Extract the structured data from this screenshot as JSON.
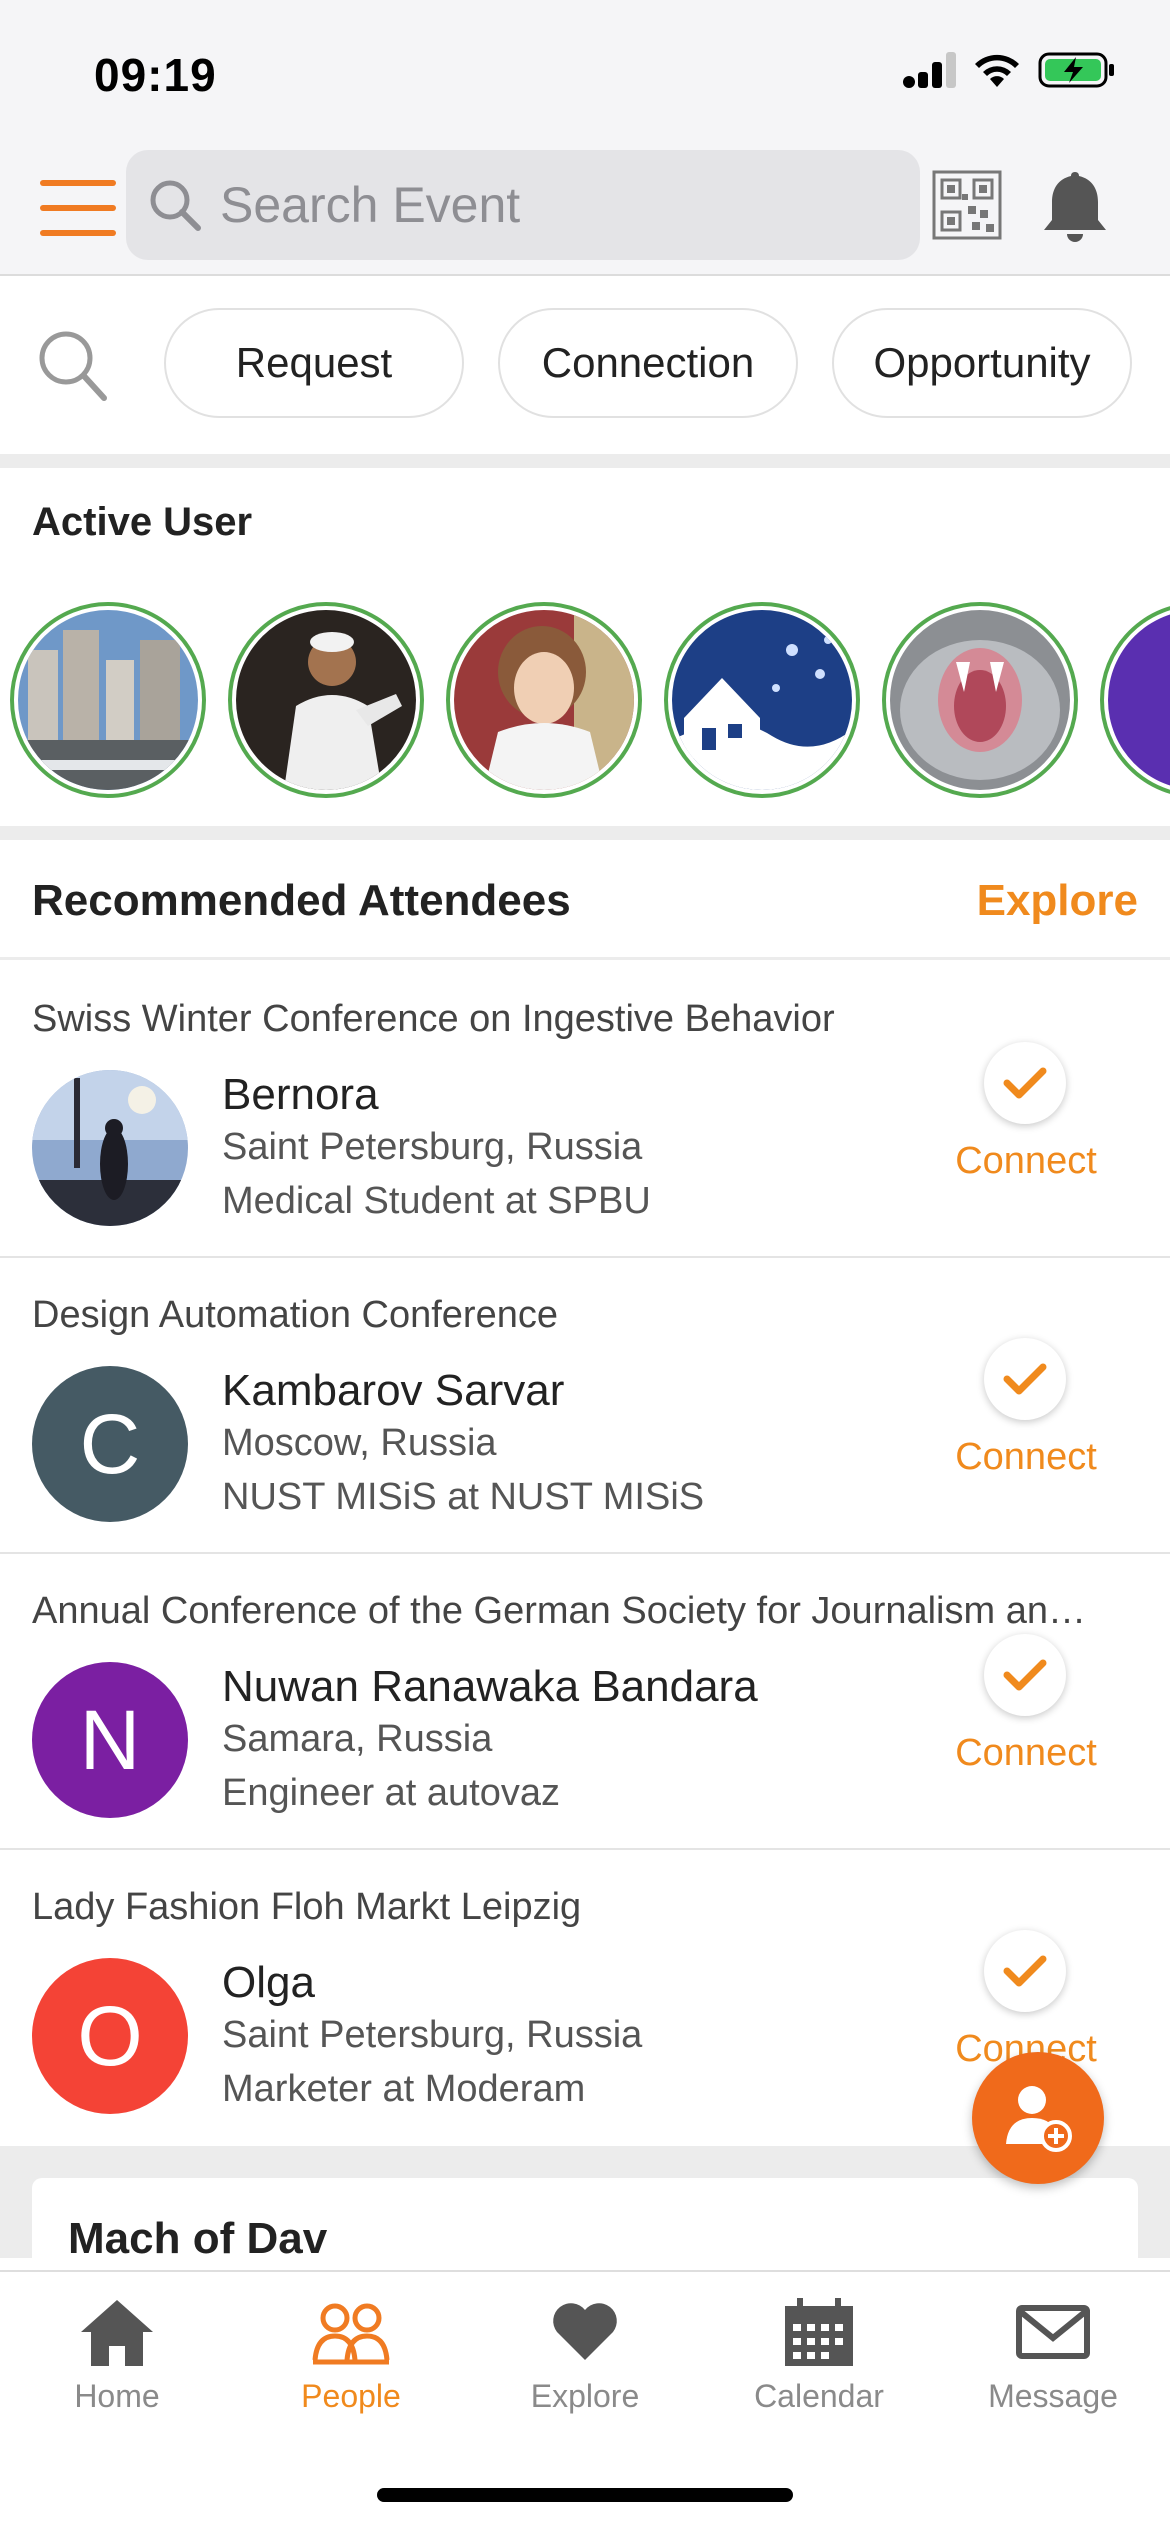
{
  "status_bar": {
    "time": "09:19"
  },
  "header": {
    "search_placeholder": "Search Event"
  },
  "filters": {
    "chips": [
      "Request",
      "Connection",
      "Opportunity"
    ]
  },
  "active_user": {
    "title": "Active User"
  },
  "recommended": {
    "title": "Recommended Attendees",
    "explore_label": "Explore",
    "attendees": [
      {
        "event": "Swiss Winter Conference on Ingestive Behavior",
        "name": "Bernora",
        "location": "Saint Petersburg, Russia",
        "job": "Medical Student at SPBU",
        "initial": "",
        "color": "",
        "connect": "Connect"
      },
      {
        "event": "Design Automation Conference",
        "name": "Kambarov Sarvar",
        "location": "Moscow, Russia",
        "job": "NUST MISiS at NUST MISiS",
        "initial": "C",
        "color": "#455a64",
        "connect": "Connect"
      },
      {
        "event": "Annual Conference of the German Society for Journalism an…",
        "name": "Nuwan Ranawaka Bandara",
        "location": "Samara, Russia",
        "job": "Engineer at autovaz",
        "initial": "N",
        "color": "#7b1fa2",
        "connect": "Connect"
      },
      {
        "event": "Lady Fashion Floh Markt Leipzig",
        "name": "Olga",
        "location": "Saint Petersburg, Russia",
        "job": "Marketer at Moderam",
        "initial": "O",
        "color": "#f44336",
        "connect": "Connect"
      }
    ]
  },
  "next_section": {
    "title": "Mach of Dav"
  },
  "tabs": [
    {
      "label": "Home",
      "icon": "home-icon",
      "active": false
    },
    {
      "label": "People",
      "icon": "people-icon",
      "active": true
    },
    {
      "label": "Explore",
      "icon": "heart-icon",
      "active": false
    },
    {
      "label": "Calendar",
      "icon": "calendar-icon",
      "active": false
    },
    {
      "label": "Message",
      "icon": "envelope-icon",
      "active": false
    }
  ],
  "colors": {
    "accent": "#f08a1d",
    "ring": "#54a94f"
  }
}
